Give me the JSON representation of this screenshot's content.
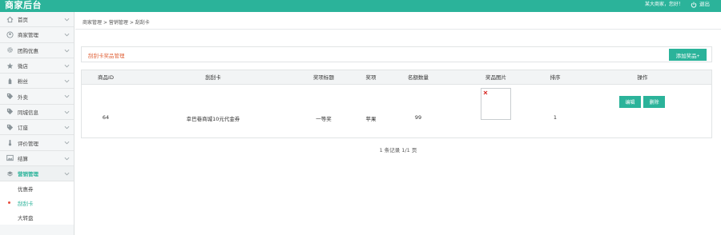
{
  "header": {
    "brand": "商家后台",
    "greeting": "某大商家，您好！",
    "logout_label": "退出",
    "accent_color": "#2bb39a"
  },
  "sidebar": {
    "items": [
      {
        "label": "首页",
        "icon": "home-icon"
      },
      {
        "label": "商家管理",
        "icon": "user-circle-icon"
      },
      {
        "label": "团购优惠",
        "icon": "gear-icon"
      },
      {
        "label": "微店",
        "icon": "star-icon"
      },
      {
        "label": "粉丝",
        "icon": "hand-icon"
      },
      {
        "label": "外卖",
        "icon": "tag-icon"
      },
      {
        "label": "同城信息",
        "icon": "tag-icon"
      },
      {
        "label": "订座",
        "icon": "tag-icon"
      },
      {
        "label": "评价管理",
        "icon": "thermometer-icon"
      },
      {
        "label": "结算",
        "icon": "image-icon"
      },
      {
        "label": "营销管理",
        "icon": "layers-icon"
      }
    ],
    "sub_items": [
      {
        "label": "优惠券"
      },
      {
        "label": "刮刮卡"
      },
      {
        "label": "大转盘"
      }
    ]
  },
  "breadcrumb": {
    "items": [
      "商家管理",
      "营销管理",
      "刮刮卡"
    ],
    "separator": ">"
  },
  "panel": {
    "title": "刮刮卡奖品管理",
    "add_button": "添加奖品+",
    "title_color": "#e0633a"
  },
  "table": {
    "headers": [
      "商品ID",
      "刮刮卡",
      "奖项标题",
      "奖项",
      "名额数量",
      "奖品图片",
      "排序",
      "操作"
    ],
    "rows": [
      {
        "id": "64",
        "card": "幸巴巷商城10元代金券",
        "prize_title": "一等奖",
        "prize": "苹果",
        "quota": "99",
        "sort": "1",
        "edit_label": "编辑",
        "delete_label": "删除"
      }
    ]
  },
  "pagination": {
    "text": "1 条记录 1/1 页"
  }
}
